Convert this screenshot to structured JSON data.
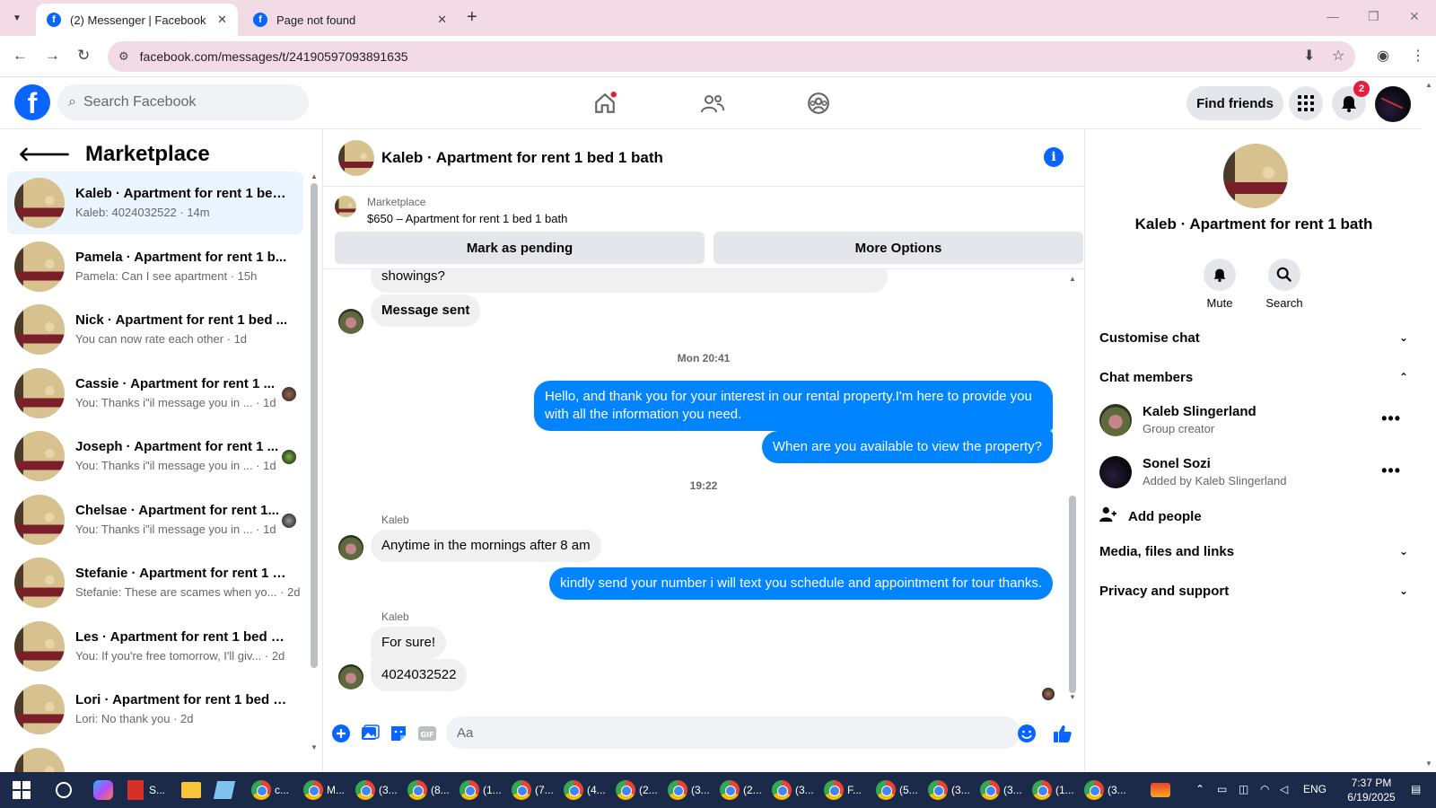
{
  "browser": {
    "tabs": [
      {
        "title": "(2) Messenger | Facebook",
        "active": true
      },
      {
        "title": "Page not found",
        "active": false
      }
    ],
    "url": "facebook.com/messages/t/24190597093891635"
  },
  "fb_header": {
    "search_placeholder": "Search Facebook",
    "find_friends": "Find friends",
    "notification_count": "2"
  },
  "sidebar": {
    "title": "Marketplace",
    "conversations": [
      {
        "name": "Kaleb · Apartment for rent 1 bed...",
        "snippet": "Kaleb: 4024032522 · 14m",
        "active": true
      },
      {
        "name": "Pamela · Apartment for rent 1 b...",
        "snippet": "Pamela: Can I see apartment · 15h"
      },
      {
        "name": "Nick · Apartment for rent 1 bed ...",
        "snippet": "You can now rate each other · 1d"
      },
      {
        "name": "Cassie · Apartment for rent 1 ...",
        "snippet": "You: Thanks i\"il message you in ... · 1d"
      },
      {
        "name": "Joseph · Apartment for rent 1 ...",
        "snippet": "You: Thanks i\"il message you in ... · 1d"
      },
      {
        "name": "Chelsae · Apartment for rent 1...",
        "snippet": "You: Thanks i\"il message you in ... · 1d"
      },
      {
        "name": "Stefanie · Apartment for rent 1 b...",
        "snippet": "Stefanie: These are scames when yo... · 2d"
      },
      {
        "name": "Les · Apartment for rent 1 bed 1 ...",
        "snippet": "You: If you're free tomorrow, I'll giv... · 2d"
      },
      {
        "name": "Lori · Apartment for rent 1 bed 1...",
        "snippet": "Lori: No thank you · 2d"
      }
    ]
  },
  "chat": {
    "title": "Kaleb · Apartment for rent 1 bed 1 bath",
    "listing_source": "Marketplace",
    "listing_price": "$650 – Apartment for rent 1 bed 1 bath",
    "mark_pending": "Mark as pending",
    "more_options": "More Options",
    "messages": {
      "m0": "showings?",
      "m1": "Message sent",
      "ts1": "Mon 20:41",
      "m2": "Hello, and thank you for your interest in our rental property.I'm here to provide you with all the information you need.",
      "m3": "When are you available to view the property?",
      "ts2": "19:22",
      "sender1": "Kaleb",
      "m4": "Anytime in the mornings after 8 am",
      "m5": "kindly send your number i will text you schedule and appointment for tour thanks.",
      "sender2": "Kaleb",
      "m6": "For sure!",
      "m7": "4024032522"
    },
    "composer_placeholder": "Aa"
  },
  "right_panel": {
    "name": "Kaleb · Apartment for rent 1 bath",
    "mute": "Mute",
    "search": "Search",
    "customise_chat": "Customise chat",
    "chat_members": "Chat members",
    "members": [
      {
        "name": "Kaleb Slingerland",
        "role": "Group creator"
      },
      {
        "name": "Sonel Sozi",
        "role": "Added by Kaleb Slingerland"
      }
    ],
    "add_people": "Add people",
    "media_files": "Media, files and links",
    "privacy_support": "Privacy and support"
  },
  "taskbar": {
    "apps": [
      "S...",
      "",
      "",
      "c...",
      "M...",
      "(3...",
      "(8...",
      "(1...",
      "(7...",
      "(4...",
      "(2...",
      "(3...",
      "(2...",
      "(3...",
      "F...",
      "(5...",
      "(3...",
      "(3...",
      "(1...",
      "(3..."
    ],
    "lang": "ENG",
    "time": "7:37 PM",
    "date": "6/19/2025"
  },
  "colors": {
    "fb_blue": "#0866ff",
    "messenger_blue": "#0084ff",
    "tab_bg": "#f3dbe5"
  }
}
